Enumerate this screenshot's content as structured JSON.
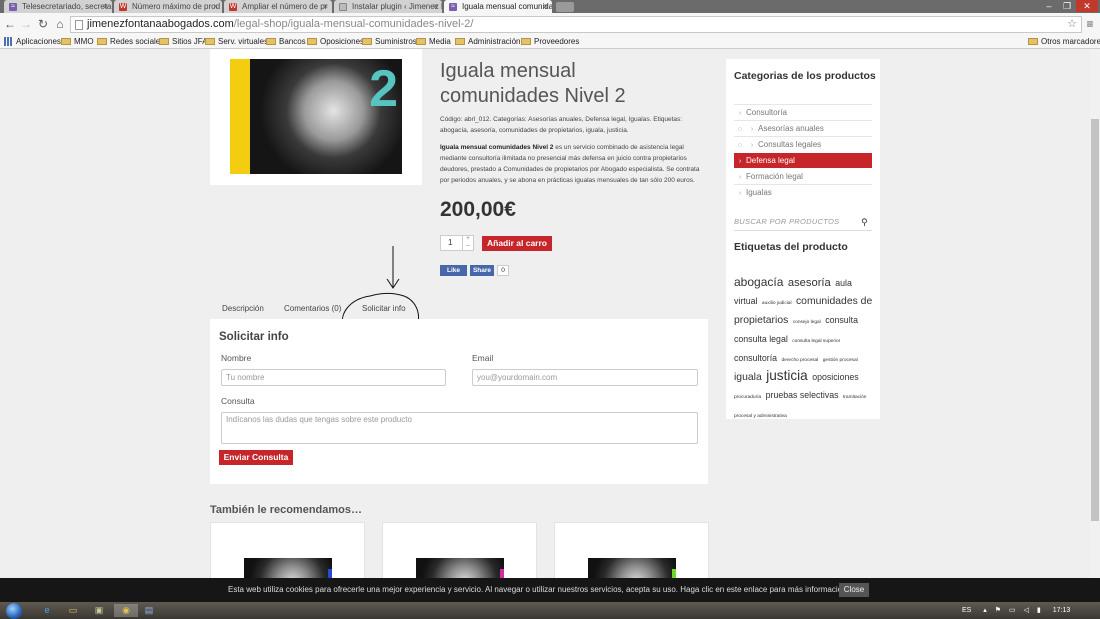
{
  "browser": {
    "tabs": [
      {
        "label": "Telesecretariado, secretar",
        "icon": "bird-icon",
        "active": false
      },
      {
        "label": "Número máximo de prod",
        "icon": "wp-icon",
        "active": false
      },
      {
        "label": "Ampliar el número de pr",
        "icon": "wp-icon",
        "active": false
      },
      {
        "label": "Instalar plugin ‹ Jimenez F",
        "icon": "page-icon",
        "active": false
      },
      {
        "label": "Iguala mensual comunida",
        "icon": "bird-icon",
        "active": true
      }
    ],
    "url_domain": "jimenezfontanaabogados.com",
    "url_path": "/legal-shop/iguala-mensual-comunidades-nivel-2/",
    "bookmarks": [
      "Aplicaciones",
      "MMO",
      "Redes sociales",
      "Sitios JFA",
      "Serv. virtuales",
      "Bancos",
      "Oposiciones",
      "Suministros",
      "Media",
      "Administración",
      "Proveedores"
    ],
    "other_bookmarks": "Otros marcadores"
  },
  "product": {
    "title": "Iguala mensual comunidades Nivel 2",
    "image_number": "2",
    "meta_line1": "Código: abrl_012. Categorías: Asesorías anuales, Defensa legal, Igualas. Etiquetas:",
    "meta_line2": "abogacía, asesoría, comunidades de propietarios, iguala, justicia.",
    "desc_bold": "Iguala mensual comunidades Nivel 2",
    "desc_lines": [
      " es un servicio combinado de asistencia legal",
      "mediante consultoría ilimitada no presencial más defensa en juicio contra propietarios",
      "deudores, prestado a Comunidades de propietarios por Abogado especialista. Se contrata",
      "por periodos anuales, y se abona en prácticas igualas mensuales de tan sólo 200 euros."
    ],
    "price": "200,00€",
    "quantity": "1",
    "add_to_cart": "Añadir al carro",
    "like": "Like",
    "share": "Share",
    "share_count": "0"
  },
  "tabs": {
    "description": "Descripción",
    "comments": "Comentarios (0)",
    "request": "Solicitar info"
  },
  "form": {
    "title": "Solicitar info",
    "name_label": "Nombre",
    "name_placeholder": "Tu nombre",
    "email_label": "Email",
    "email_placeholder": "you@yourdomain.com",
    "query_label": "Consulta",
    "query_placeholder": "Indícanos las dudas que tengas sobre este producto",
    "send": "Enviar Consulta"
  },
  "related": {
    "title": "También le recomendamos…",
    "accents": [
      "#2a49d6",
      "#d62aa8",
      "#6fd62a"
    ]
  },
  "sidebar": {
    "categories_title": "Categorias de los productos",
    "categories": [
      {
        "label": "Consultoría",
        "level": 0,
        "selected": false
      },
      {
        "label": "Asesorías anuales",
        "level": 1,
        "selected": false
      },
      {
        "label": "Consultas legales",
        "level": 1,
        "selected": false
      },
      {
        "label": "Defensa legal",
        "level": 0,
        "selected": true
      },
      {
        "label": "Formación legal",
        "level": 0,
        "selected": false
      },
      {
        "label": "Igualas",
        "level": 0,
        "selected": false
      }
    ],
    "search_placeholder": "BUSCAR POR PRODUCTOS",
    "tags_title": "Etiquetas del producto",
    "tags": [
      {
        "t": "abogacía",
        "s": 15
      },
      {
        "t": "asesoría",
        "s": 14
      },
      {
        "t": "aula virtual",
        "s": 11
      },
      {
        "t": "auxilio judicial",
        "s": 6
      },
      {
        "t": "comunidades de propietarios",
        "s": 13
      },
      {
        "t": "consejo legal",
        "s": 6
      },
      {
        "t": "consulta",
        "s": 11
      },
      {
        "t": "consulta legal",
        "s": 11
      },
      {
        "t": "consulta legal superior",
        "s": 6
      },
      {
        "t": "consultoría",
        "s": 11
      },
      {
        "t": "derecho procesal",
        "s": 6
      },
      {
        "t": "gestión procesal",
        "s": 6
      },
      {
        "t": "iguala",
        "s": 13
      },
      {
        "t": "justicia",
        "s": 17
      },
      {
        "t": "oposiciones",
        "s": 11
      },
      {
        "t": "procuraduría",
        "s": 6
      },
      {
        "t": "pruebas selectivas",
        "s": 11
      },
      {
        "t": "tramitación procesal y administrativa",
        "s": 6
      }
    ]
  },
  "cookie": {
    "message": "Esta web utiliza cookies para ofrecerle una mejor experiencia y servicio. Al navegar o utilizar nuestros servicios, acepta su uso. Haga clic en este enlace para más información",
    "close": "Close"
  },
  "taskbar": {
    "language": "ES",
    "time": "17:13"
  }
}
